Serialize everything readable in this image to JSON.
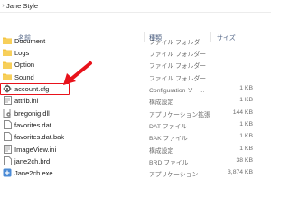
{
  "breadcrumb": {
    "current": "Jane Style"
  },
  "columns": {
    "name": "名前",
    "type": "種類",
    "size": "サイズ"
  },
  "files": [
    {
      "name": "Document",
      "type": "ファイル フォルダー",
      "size": "",
      "icon": "folder-icon"
    },
    {
      "name": "Logs",
      "type": "ファイル フォルダー",
      "size": "",
      "icon": "folder-icon"
    },
    {
      "name": "Option",
      "type": "ファイル フォルダー",
      "size": "",
      "icon": "folder-icon"
    },
    {
      "name": "Sound",
      "type": "ファイル フォルダー",
      "size": "",
      "icon": "folder-icon"
    },
    {
      "name": "account.cfg",
      "type": "Configuration ソー...",
      "size": "1 KB",
      "icon": "gear-file-icon"
    },
    {
      "name": "attrib.ini",
      "type": "構成設定",
      "size": "1 KB",
      "icon": "ini-file-icon"
    },
    {
      "name": "bregonig.dll",
      "type": "アプリケーション拡張",
      "size": "144 KB",
      "icon": "dll-file-icon"
    },
    {
      "name": "favorites.dat",
      "type": "DAT ファイル",
      "size": "1 KB",
      "icon": "generic-file-icon"
    },
    {
      "name": "favorites.dat.bak",
      "type": "BAK ファイル",
      "size": "1 KB",
      "icon": "generic-file-icon"
    },
    {
      "name": "ImageView.ini",
      "type": "構成設定",
      "size": "1 KB",
      "icon": "ini-file-icon"
    },
    {
      "name": "jane2ch.brd",
      "type": "BRD ファイル",
      "size": "38 KB",
      "icon": "generic-file-icon"
    },
    {
      "name": "Jane2ch.exe",
      "type": "アプリケーション",
      "size": "3,874 KB",
      "icon": "app-icon"
    }
  ],
  "colors": {
    "highlight": "#e8121b",
    "arrow": "#e8121b",
    "folder": "#f5c542"
  }
}
